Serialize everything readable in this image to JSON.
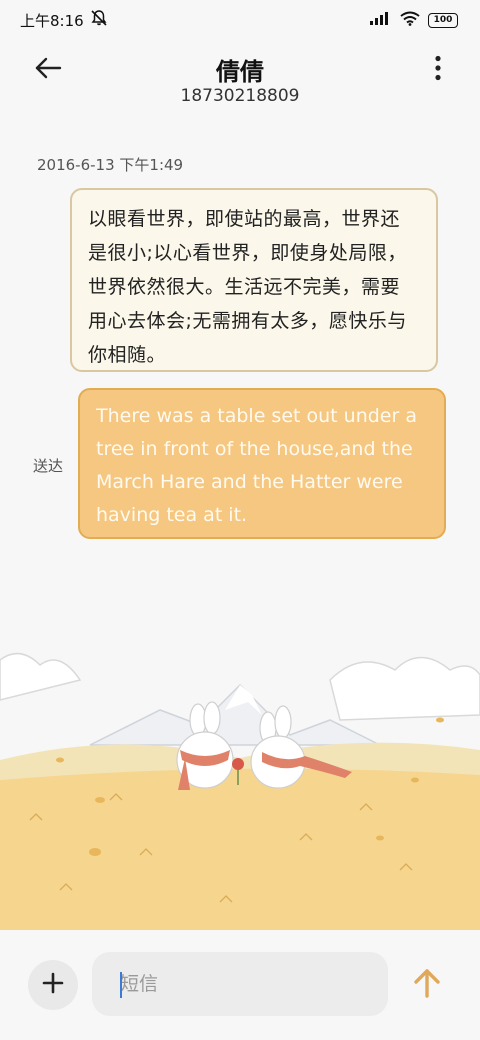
{
  "status_bar": {
    "time": "上午8:16",
    "battery": "100",
    "icons": [
      "mute-bell-icon",
      "signal-icon",
      "wifi-icon",
      "battery-icon"
    ]
  },
  "header": {
    "contact_name": "倩倩",
    "phone_number": "18730218809",
    "icons": [
      "back-arrow-icon",
      "more-vertical-icon"
    ]
  },
  "conversation": {
    "timestamp": "2016-6-13 下午1:49",
    "messages": [
      {
        "direction": "incoming",
        "lines": [
          "以眼看世界，即使站的最高，世界还",
          "是很小;以心看世界，即使身处局限，",
          "世界依然很大。生活远不完美，需要",
          "用心去体会;无需拥有太多，愿快乐与",
          "你相随。"
        ]
      },
      {
        "direction": "outgoing",
        "status": "送达",
        "lines": [
          "There was a table set out under a",
          "tree in front of the house,and the",
          "March Hare and the Hatter were",
          "having tea at it."
        ]
      }
    ]
  },
  "input_bar": {
    "placeholder": "短信",
    "icons": [
      "add-icon",
      "send-arrow-icon"
    ]
  },
  "colors": {
    "incoming_bubble": "#fbf7ea",
    "outgoing_bubble": "#f5c780",
    "accent": "#e0a85a"
  }
}
